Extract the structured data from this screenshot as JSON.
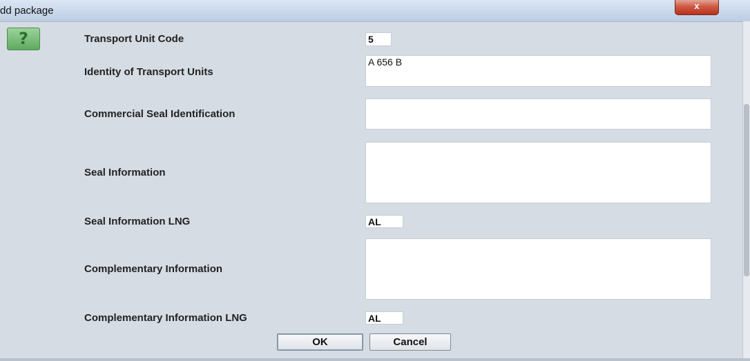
{
  "window": {
    "title": "dd package",
    "close_symbol": "x"
  },
  "help": {
    "icon": "help-question-icon",
    "glyph": "?"
  },
  "form": {
    "transport_unit_code": {
      "label": "Transport Unit Code",
      "value": "5"
    },
    "identity_of_transport_units": {
      "label": "Identity of Transport Units",
      "value": "A 656 B"
    },
    "commercial_seal_identification": {
      "label": "Commercial Seal Identification",
      "value": ""
    },
    "seal_information": {
      "label": "Seal Information",
      "value": ""
    },
    "seal_information_lng": {
      "label": "Seal Information LNG",
      "value": "AL"
    },
    "complementary_information": {
      "label": "Complementary Information",
      "value": ""
    },
    "complementary_information_lng": {
      "label": "Complementary Information LNG",
      "value": "AL"
    }
  },
  "buttons": {
    "ok": "OK",
    "cancel": "Cancel"
  },
  "colors": {
    "background": "#d6dce4",
    "close_button": "#cf5a45",
    "help_icon": "#6fb86f"
  }
}
